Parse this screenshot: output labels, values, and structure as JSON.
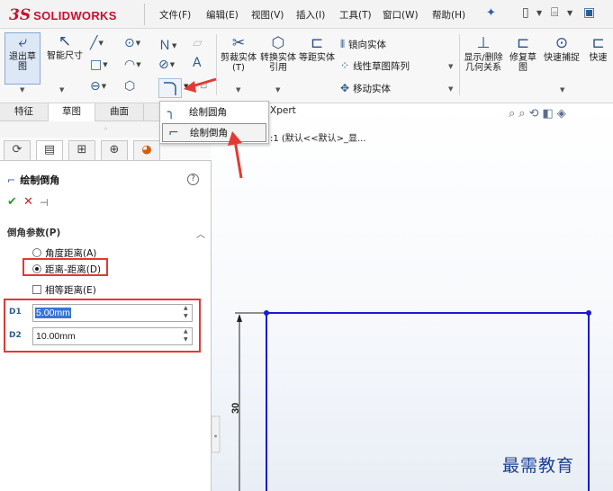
{
  "app": {
    "logo_prefix": "3S",
    "logo_text": "SOLIDWORKS",
    "menus": [
      "文件(F)",
      "编辑(E)",
      "视图(V)",
      "插入(I)",
      "工具(T)",
      "窗口(W)",
      "帮助(H)"
    ]
  },
  "ribbon": {
    "exit_sketch": "退出草图",
    "smart_dimension": "智能尺寸",
    "trim_entities": "剪裁实体(T)",
    "convert_entities": "转换实体引用",
    "offset_entities": "等距实体",
    "mirror_entities": "镜向实体",
    "linear_pattern": "线性草图阵列",
    "move_entities": "移动实体",
    "display_relations": "显示/删除几何关系",
    "repair_sketch": "修复草图",
    "quick_snaps": "快速捕捉",
    "quick_view": "快速"
  },
  "tabs": [
    "特征",
    "草图",
    "曲面"
  ],
  "dropdown": {
    "items": [
      "绘制圆角",
      "绘制倒角"
    ],
    "selected_index": 1
  },
  "xpert_label": "Xpert",
  "breadcrumb": ":1  (默认<<默认>_显...",
  "panel": {
    "title": "绘制倒角",
    "help_label": "?",
    "section_title": "倒角参数(P)",
    "options": [
      "角度距离(A)",
      "距离-距离(D)"
    ],
    "selected_option": 1,
    "equal_distance_label": "相等距离(E)",
    "equal_distance_checked": false,
    "d1_label": "D1",
    "d2_label": "D2",
    "d1_value": "5.00mm",
    "d2_value": "10.00mm"
  },
  "sketch": {
    "dimension_label": "30"
  },
  "watermark": "最需教育",
  "colors": {
    "brand": "#c8102e",
    "highlight": "#e23a32",
    "sketch_line": "#1a1ad0",
    "selection": "#3875d7"
  }
}
